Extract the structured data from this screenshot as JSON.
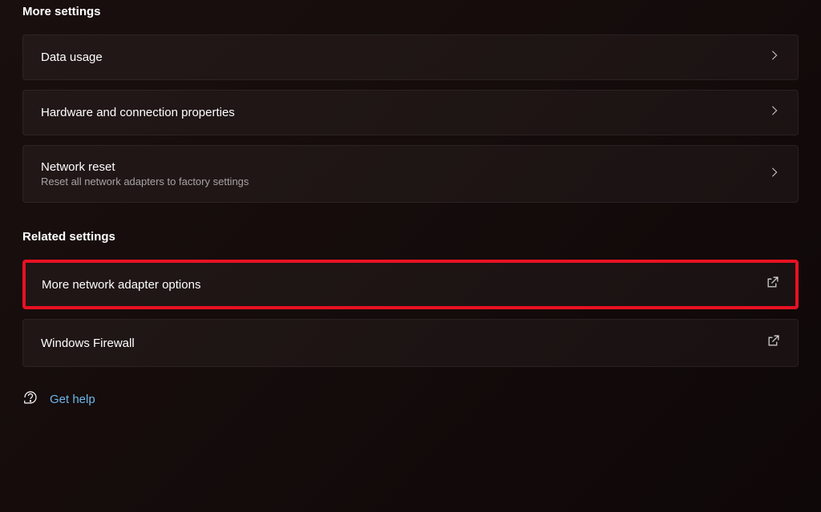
{
  "sections": {
    "more_settings": {
      "heading": "More settings",
      "items": {
        "data_usage": {
          "label": "Data usage"
        },
        "hardware": {
          "label": "Hardware and connection properties"
        },
        "network_reset": {
          "label": "Network reset",
          "sublabel": "Reset all network adapters to factory settings"
        }
      }
    },
    "related_settings": {
      "heading": "Related settings",
      "items": {
        "adapter_options": {
          "label": "More network adapter options"
        },
        "firewall": {
          "label": "Windows Firewall"
        }
      }
    }
  },
  "help": {
    "label": "Get help"
  },
  "colors": {
    "highlight": "#e81123",
    "link": "#6bb7e8"
  }
}
